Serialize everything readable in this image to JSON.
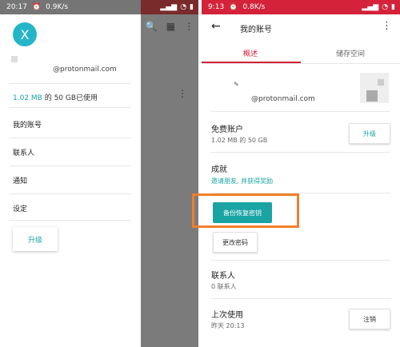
{
  "left": {
    "status": {
      "time": "20:17",
      "speed": "0.9K/s"
    },
    "avatar_letter": "X",
    "email": "@protonmail.com",
    "usage": {
      "used": "1.02 MB",
      "rest": " 的 50 GB已使用"
    },
    "menu": [
      "我的账号",
      "联系人",
      "通知",
      "设定"
    ],
    "upgrade_label": "升级"
  },
  "right": {
    "status": {
      "time": "9:13",
      "speed": "0.8K/s"
    },
    "title": "我的账号",
    "tabs": [
      "概述",
      "储存空间"
    ],
    "email": "@protonmail.com",
    "plan": {
      "title": "免费账户",
      "usage": "1.02 MB 的 50 GB",
      "upgrade_label": "升级"
    },
    "achievements": {
      "title": "成就",
      "link": "邀请朋友, 并获得奖励"
    },
    "backup_label": "备份恢复密钥",
    "change_password_label": "更改密码",
    "contacts": {
      "title": "联系人",
      "count": "0 联系人"
    },
    "last_used": {
      "title": "上次使用",
      "time": "昨天 20:13",
      "logout_label": "注销"
    }
  },
  "colors": {
    "accent": "#1aa3a3",
    "brand_red": "#d3223a",
    "highlight": "#f07f2a"
  }
}
